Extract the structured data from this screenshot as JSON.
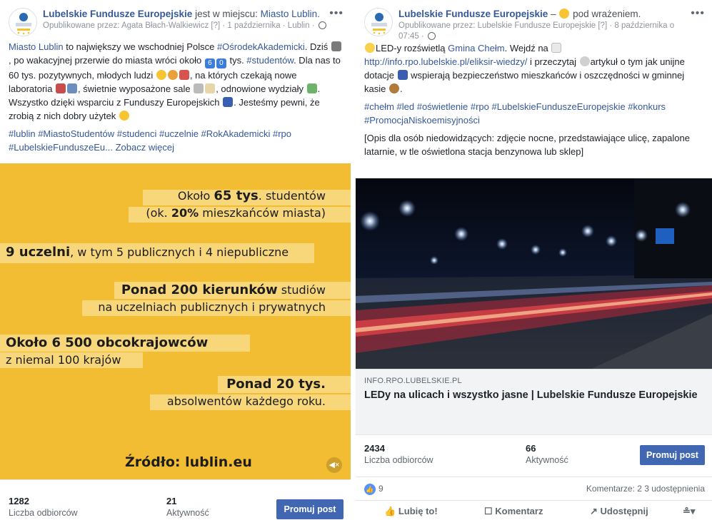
{
  "left": {
    "page_name": "Lubelskie Fundusze Europejskie",
    "activity": " jest w miejscu: ",
    "place": "Miasto Lublin.",
    "more": "•••",
    "sub": "Opublikowane przez: Agata Błach-Walkiewicz [?] · 1 października · Lublin ·",
    "text": {
      "p1_link1": "Miasto Lublin",
      "p1_a": " to największy we wschodniej Polsce ",
      "p1_tag1": "#OśrodekAkademicki",
      "p1_b": ". Dziś ",
      "p1_c": ", po wakacyjnej przerwie do miasta wróci około ",
      "p1_d": " tys. ",
      "p1_tag2": "#studentów",
      "p1_e": ". Dla nas to 60 tys. pozytywnych, młodych ludzi ",
      "p1_f": ", na których czekają nowe laboratoria ",
      "p1_g": ", świetnie wyposażone sale ",
      "p1_h": ", odnowione wydziały ",
      "p1_i": ". Wszystko dzięki wsparciu z Funduszy Europejskich ",
      "p1_j": ". Jesteśmy pewni, że zrobią z nich dobry użytek ",
      "num6": "6",
      "num0": "0"
    },
    "hashtags": "#lublin #MiastoStudentów #studenci #uczelnie #RokAkademicki #rpo #LubelskieFunduszeEu...",
    "see_more": "Zobacz więcej",
    "infographic": {
      "l1a": "Około ",
      "l1b": "65 tys",
      "l1c": ". studentów",
      "l2a": "(ok. ",
      "l2b": "20%",
      "l2c": " mieszkańców miasta)",
      "l3a": "9 uczelni",
      "l3b": ", w tym 5 publicznych i 4 niepubliczne",
      "l4a": "Ponad ",
      "l4b": "200 kierunków",
      "l4c": " studiów",
      "l5a": "na ",
      "l5b": "uczelniach",
      "l5c": " publicznych i prywatnych",
      "l6": "Około 6 500 obcokrajowców",
      "l7": "z niemal 100 krajów",
      "l8": "Ponad 20 tys.",
      "l9a": "absolwen",
      "l9b": "tów",
      "l9c": " każdego roku.",
      "source": "Źródło: lublin.eu",
      "bg_color": "#f2bc33"
    },
    "stats": {
      "reach_n": "1282",
      "reach_l": "Liczba odbiorców",
      "eng_n": "21",
      "eng_l": "Aktywność",
      "promote": "Promuj post"
    }
  },
  "right": {
    "page_name": "Lubelskie Fundusze Europejskie",
    "activity": " – ",
    "feeling": " pod wrażeniem.",
    "more": "•••",
    "sub": "Opublikowane przez: Lubelskie Fundusze Europejskie [?] · 8 października o 07:45 ·",
    "text": {
      "a": "LED-y rozświetlą ",
      "link1": "Gmina Chełm",
      "b": ". Wejdź na ",
      "url": "http://info.rpo.lubelskie.pl/eliksir-wiedzy/",
      "c": " i przeczytaj ",
      "d": "artykuł o tym jak unijne dotacje ",
      "e": " wspierają bezpieczeństwo mieszkańców i oszczędności w gminnej kasie ",
      "f": "."
    },
    "hashtags": "#chełm #led #oświetlenie #rpo #LubelskieFunduszeEuropejskie #konkurs #PromocjaNiskoemisyjności",
    "alt_desc": "[Opis dla osób niedowidzących: zdjęcie nocne, przedstawiające ulicę, zapalone latarnie, w tle oświetlona stacja benzynowa lub sklep]",
    "link": {
      "domain": "INFO.RPO.LUBELSKIE.PL",
      "title": "LEDy na ulicach i wszystko jasne | Lubelskie Fundusze Europejskie"
    },
    "stats": {
      "reach_n": "2434",
      "reach_l": "Liczba odbiorców",
      "eng_n": "66",
      "eng_l": "Aktywność",
      "promote": "Promuj post"
    },
    "reactions": {
      "likes": "9",
      "summary": "Komentarze: 2  3 udostępnienia"
    },
    "actions": {
      "like": "Lubię to!",
      "comment": "Komentarz",
      "share": "Udostępnij"
    }
  }
}
